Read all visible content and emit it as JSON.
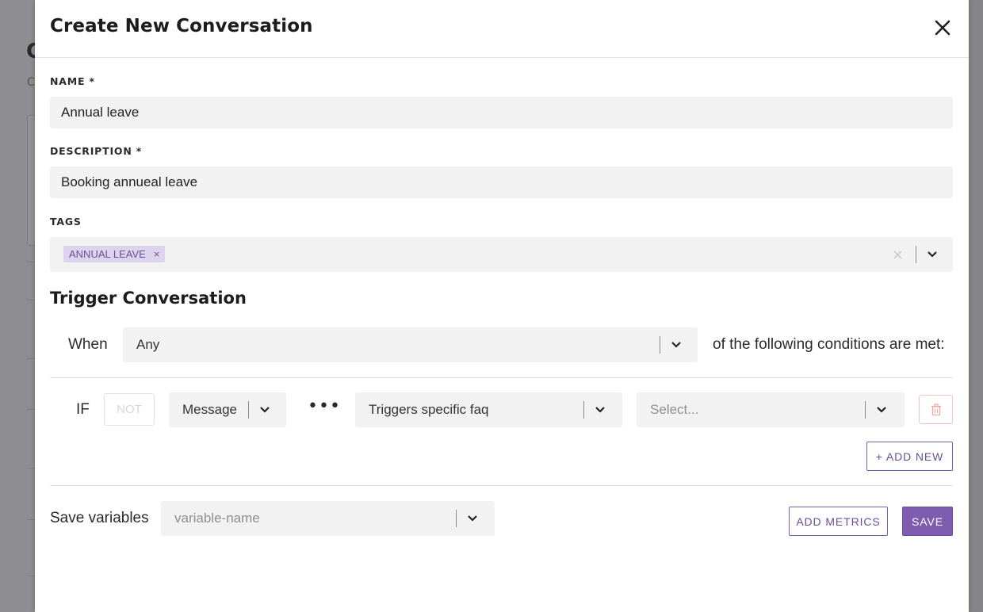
{
  "background": {
    "title_fragment": "C",
    "subtitle_fragment": "C"
  },
  "modal": {
    "title": "Create New Conversation",
    "close_icon": "close-icon"
  },
  "form": {
    "name_label": "NAME *",
    "name_value": "Annual leave",
    "description_label": "DESCRIPTION *",
    "description_value": "Booking annueal leave",
    "tags_label": "TAGS",
    "tags": [
      {
        "label": "ANNUAL LEAVE",
        "remove": "×"
      }
    ],
    "tags_clear": "×"
  },
  "trigger": {
    "section_title": "Trigger Conversation",
    "when_label": "When",
    "when_value": "Any",
    "conditions_text": "of the following conditions are met:",
    "condition": {
      "if_label": "IF",
      "not_label": "NOT",
      "field_value": "Message",
      "more": "•••",
      "operator_value": "Triggers specific faq",
      "target_placeholder": "Select..."
    },
    "add_new_label": "+ ADD NEW"
  },
  "footer": {
    "save_variables_label": "Save variables",
    "variable_placeholder": "variable-name",
    "add_metrics_label": "ADD METRICS",
    "save_label": "SAVE"
  },
  "colors": {
    "accent": "#7e5cb0",
    "tag_bg": "#dcd3ec",
    "input_bg": "#f2f2f2",
    "danger_border": "#f2c4c4"
  }
}
